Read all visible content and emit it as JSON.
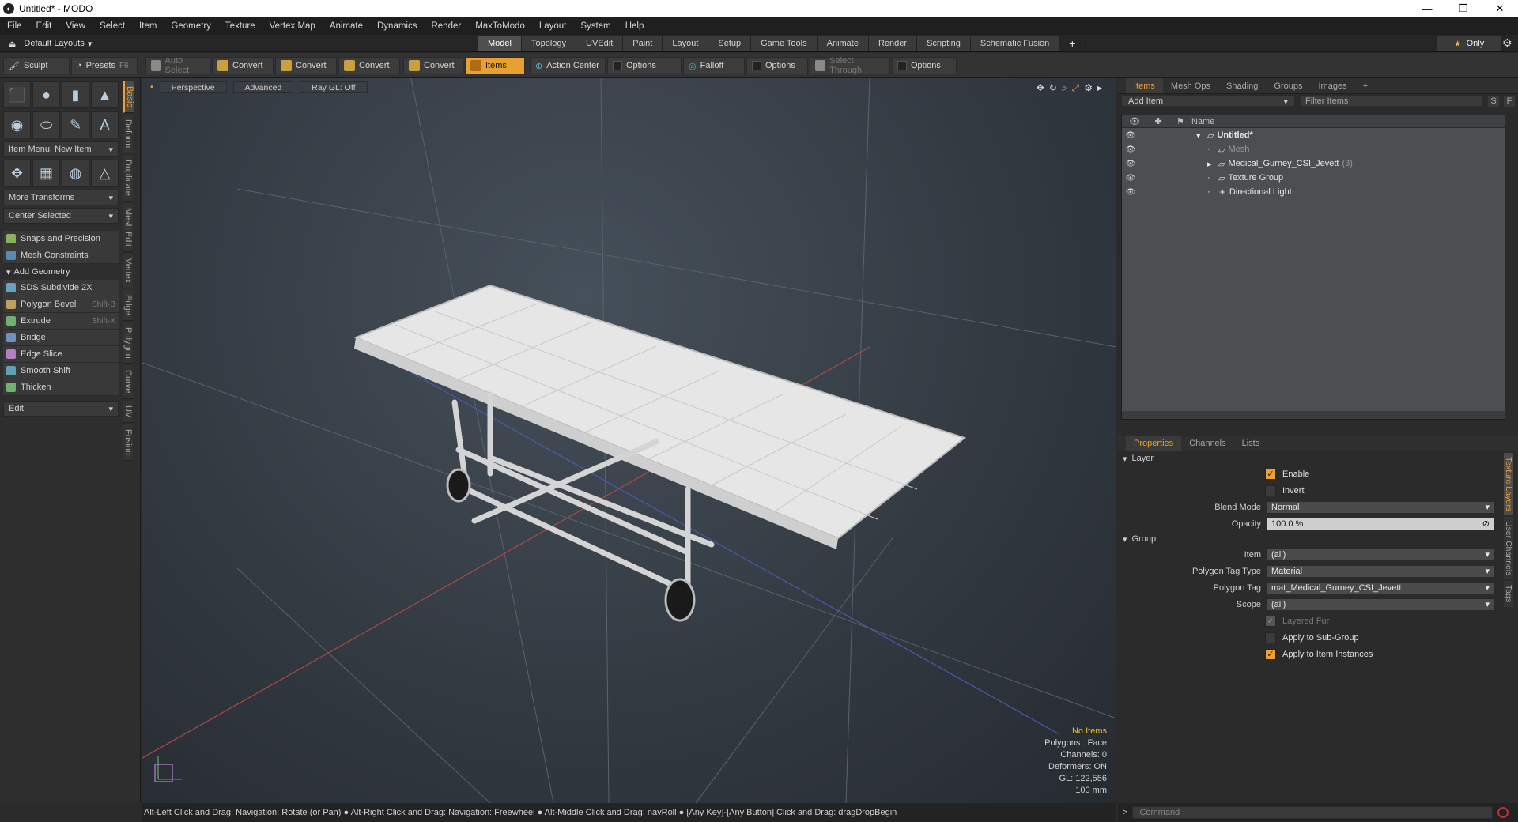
{
  "window": {
    "title": "Untitled* - MODO",
    "app_icon": "modo-logo-icon"
  },
  "menu": [
    "File",
    "Edit",
    "View",
    "Select",
    "Item",
    "Geometry",
    "Texture",
    "Vertex Map",
    "Animate",
    "Dynamics",
    "Render",
    "MaxToModo",
    "Layout",
    "System",
    "Help"
  ],
  "layout_bar": {
    "default_layouts": "Default Layouts",
    "tabs": [
      "Model",
      "Topology",
      "UVEdit",
      "Paint",
      "Layout",
      "Setup",
      "Game Tools",
      "Animate",
      "Render",
      "Scripting",
      "Schematic Fusion"
    ],
    "active_tab": "Model",
    "only_label": "Only"
  },
  "toolbar": {
    "sculpt": "Sculpt",
    "presets": "Presets",
    "presets_shortcut": "F6",
    "auto_select": "Auto Select",
    "convert": "Convert",
    "items": "Items",
    "action_center": "Action Center",
    "options": "Options",
    "falloff": "Falloff",
    "select_through": "Select Through"
  },
  "left_panel": {
    "item_menu": "Item Menu: New Item",
    "more_transforms": "More Transforms",
    "center_selected": "Center Selected",
    "snaps": "Snaps and Precision",
    "mesh_constraints": "Mesh Constraints",
    "add_geometry": "Add Geometry",
    "tools": [
      {
        "label": "SDS Subdivide 2X",
        "shortcut": ""
      },
      {
        "label": "Polygon Bevel",
        "shortcut": "Shift-B"
      },
      {
        "label": "Extrude",
        "shortcut": "Shift-X"
      },
      {
        "label": "Bridge",
        "shortcut": ""
      },
      {
        "label": "Edge Slice",
        "shortcut": ""
      },
      {
        "label": "Smooth Shift",
        "shortcut": ""
      },
      {
        "label": "Thicken",
        "shortcut": ""
      }
    ],
    "edit": "Edit",
    "vertical_tabs": [
      "Basic",
      "Deform",
      "Duplicate",
      "Mesh Edit",
      "Vertex",
      "Edge",
      "Polygon",
      "Curve",
      "UV",
      "Fusion"
    ]
  },
  "viewport": {
    "buttons": [
      "Perspective",
      "Advanced",
      "Ray GL: Off"
    ],
    "info": {
      "no_items": "No Items",
      "polygons": "Polygons : Face",
      "channels": "Channels: 0",
      "deformers": "Deformers: ON",
      "gl": "GL: 122,556",
      "scale": "100 mm"
    }
  },
  "statusbar": "Alt-Left Click and Drag: Navigation: Rotate (or Pan) ●  Alt-Right Click and Drag: Navigation: Freewheel ●  Alt-Middle Click and Drag: navRoll ●  [Any Key]-[Any Button] Click and Drag: dragDropBegin",
  "items_panel": {
    "tabs": [
      "Items",
      "Mesh Ops",
      "Shading",
      "Groups",
      "Images"
    ],
    "add_item": "Add Item",
    "filter_items": "Filter Items",
    "s": "S",
    "f": "F",
    "col_name": "Name",
    "tree": [
      {
        "name": "Untitled*",
        "indent": 0,
        "bold": true
      },
      {
        "name": "Mesh",
        "indent": 1,
        "dim": true,
        "count": ""
      },
      {
        "name": "Medical_Gurney_CSI_Jevett",
        "indent": 1,
        "count": "(3)"
      },
      {
        "name": "Texture Group",
        "indent": 1,
        "count": ""
      },
      {
        "name": "Directional Light",
        "indent": 1,
        "count": ""
      }
    ]
  },
  "properties_panel": {
    "tabs": [
      "Properties",
      "Channels",
      "Lists"
    ],
    "layer_section": "Layer",
    "enable": "Enable",
    "invert": "Invert",
    "blend_mode_label": "Blend Mode",
    "blend_mode_value": "Normal",
    "opacity_label": "Opacity",
    "opacity_value": "100.0 %",
    "group_section": "Group",
    "item_label": "Item",
    "item_value": "(all)",
    "ptag_type_label": "Polygon Tag Type",
    "ptag_type_value": "Material",
    "ptag_label": "Polygon Tag",
    "ptag_value": "mat_Medical_Gurney_CSI_Jevett",
    "scope_label": "Scope",
    "scope_value": "(all)",
    "layered_fur": "Layered Fur",
    "apply_subgroup": "Apply to Sub-Group",
    "apply_instances": "Apply to Item Instances",
    "vertical_tabs": [
      "Texture Layers",
      "User Channels",
      "Tags"
    ]
  },
  "command": {
    "placeholder": "Command"
  },
  "colors": {
    "accent": "#f0a030",
    "viewport_bg": "#333a42"
  }
}
